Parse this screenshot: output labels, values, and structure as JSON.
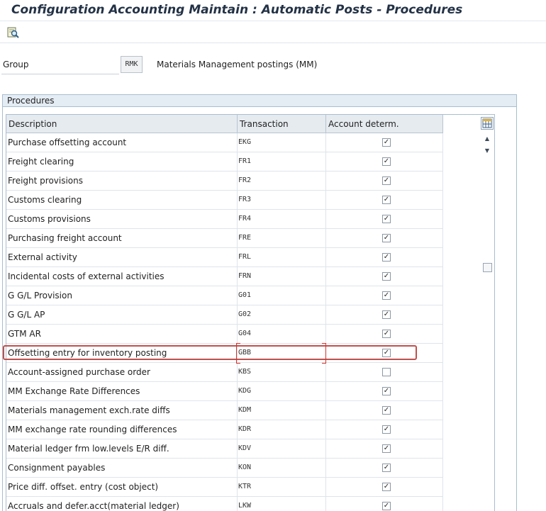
{
  "window": {
    "title": "Configuration Accounting Maintain : Automatic Posts - Procedures"
  },
  "toolbar": {
    "find_icon": "find-icon"
  },
  "group": {
    "label": "Group",
    "value": "RMK",
    "description": "Materials Management postings (MM)"
  },
  "panel": {
    "title": "Procedures"
  },
  "table": {
    "columns": [
      "Description",
      "Transaction",
      "Account determ."
    ],
    "rows": [
      {
        "description": "Purchase offsetting account",
        "transaction": "EKG",
        "account_determ": true
      },
      {
        "description": "Freight clearing",
        "transaction": "FR1",
        "account_determ": true
      },
      {
        "description": "Freight provisions",
        "transaction": "FR2",
        "account_determ": true
      },
      {
        "description": "Customs clearing",
        "transaction": "FR3",
        "account_determ": true
      },
      {
        "description": "Customs provisions",
        "transaction": "FR4",
        "account_determ": true
      },
      {
        "description": "Purchasing freight account",
        "transaction": "FRE",
        "account_determ": true
      },
      {
        "description": "External activity",
        "transaction": "FRL",
        "account_determ": true
      },
      {
        "description": "Incidental costs of external activities",
        "transaction": "FRN",
        "account_determ": true
      },
      {
        "description": "G G/L Provision",
        "transaction": "G01",
        "account_determ": true
      },
      {
        "description": "G G/L AP",
        "transaction": "G02",
        "account_determ": true
      },
      {
        "description": "GTM AR",
        "transaction": "G04",
        "account_determ": true
      },
      {
        "description": "Offsetting entry for inventory posting",
        "transaction": "GBB",
        "account_determ": true,
        "highlighted": true
      },
      {
        "description": "Account-assigned purchase order",
        "transaction": "KBS",
        "account_determ": false
      },
      {
        "description": "MM Exchange Rate Differences",
        "transaction": "KDG",
        "account_determ": true
      },
      {
        "description": "Materials management exch.rate diffs",
        "transaction": "KDM",
        "account_determ": true
      },
      {
        "description": "MM exchange rate rounding differences",
        "transaction": "KDR",
        "account_determ": true
      },
      {
        "description": "Material ledger frm low.levels E/R diff.",
        "transaction": "KDV",
        "account_determ": true
      },
      {
        "description": "Consignment payables",
        "transaction": "KON",
        "account_determ": true
      },
      {
        "description": "Price diff. offset. entry (cost object)",
        "transaction": "KTR",
        "account_determ": true
      },
      {
        "description": "Accruals and defer.acct(material ledger)",
        "transaction": "LKW",
        "account_determ": true
      }
    ]
  },
  "colors": {
    "highlight": "#c0504d",
    "header_bg": "#e6ebf0",
    "panel_title_bg": "#e4ecf4"
  },
  "icons": {
    "column_settings": "table-settings-icon",
    "scroll_up": "scroll-up-icon",
    "scroll_down": "scroll-down-icon"
  }
}
